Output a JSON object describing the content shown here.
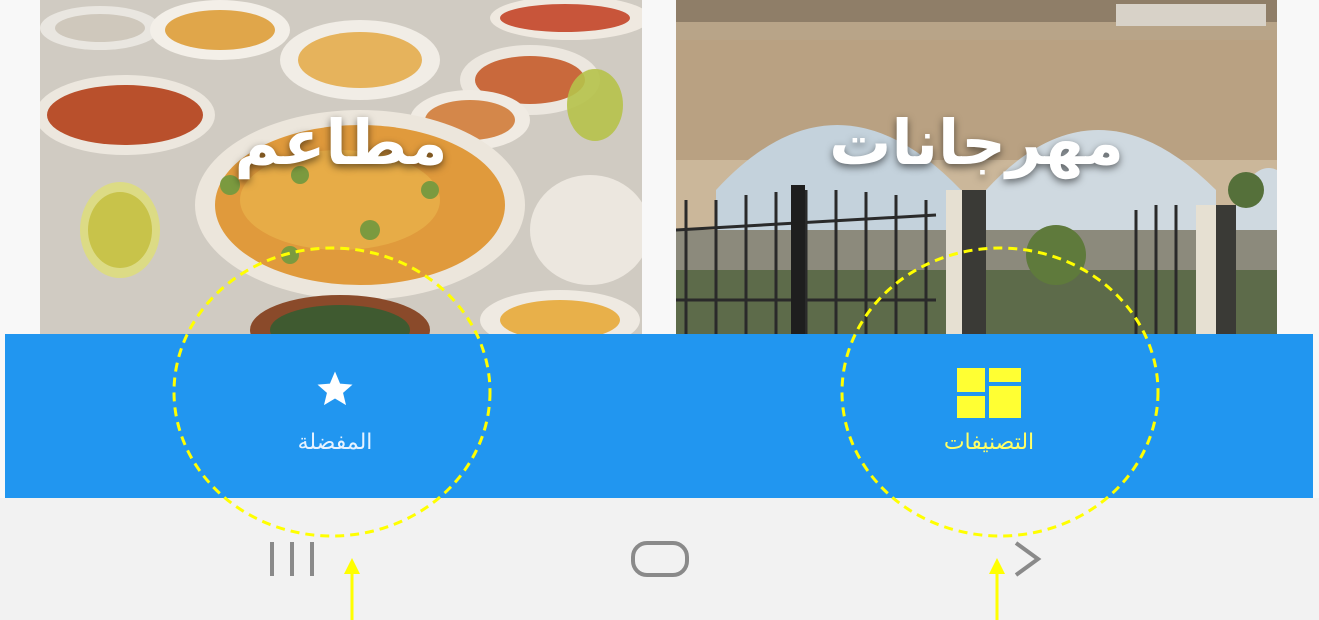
{
  "cards": [
    {
      "title": "مطاعم",
      "image": "restaurant-food-photo"
    },
    {
      "title": "مهرجانات",
      "image": "festival-gate-photo"
    }
  ],
  "bottom_nav": {
    "favorites_label": "المفضلة",
    "categories_label": "التصنيفات",
    "favorites_icon": "star-icon",
    "categories_icon": "grid-icon"
  },
  "colors": {
    "nav_background": "#2196f0",
    "active_item": "#ffff66",
    "inactive_item": "#ffffff",
    "highlight": "#ffff00"
  },
  "system_nav": {
    "recents_icon": "recents-icon",
    "home_icon": "home-icon",
    "back_icon": "back-icon"
  }
}
